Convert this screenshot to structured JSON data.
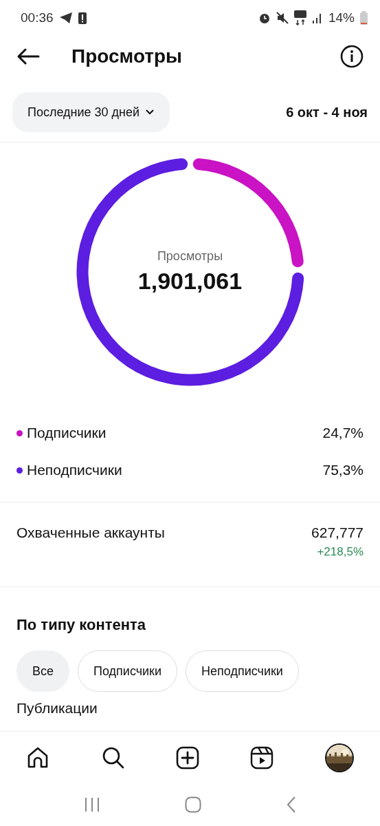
{
  "status_bar": {
    "time": "00:36",
    "battery": "14%"
  },
  "header": {
    "title": "Просмотры"
  },
  "filter": {
    "period": "Последние 30 дней",
    "range": "6 окт - 4 ноя"
  },
  "summary": {
    "label": "Просмотры",
    "total": "1,901,061",
    "chart_data": {
      "type": "donut",
      "categories": [
        "Подписчики",
        "Неподписчики"
      ],
      "values": [
        24.7,
        75.3
      ]
    }
  },
  "legend": [
    {
      "value": "24,7%",
      "color": "#c913c4"
    },
    {
      "value": "75,3%",
      "color": "#5c1ee0"
    }
  ],
  "reach": {
    "label": "Охваченные аккаунты",
    "value": "627,777",
    "change": "+218,5%"
  },
  "content_type": {
    "title": "По типу контента",
    "chips": [
      {
        "label": "Все",
        "selected": true
      },
      {
        "label": "Подписчики",
        "selected": false
      },
      {
        "label": "Неподписчики",
        "selected": false
      }
    ],
    "next_section": "Публикации"
  },
  "nav": [
    {
      "kind": "home"
    },
    {
      "kind": "search"
    },
    {
      "kind": "create"
    },
    {
      "kind": "reels"
    },
    {
      "kind": "profile"
    }
  ]
}
